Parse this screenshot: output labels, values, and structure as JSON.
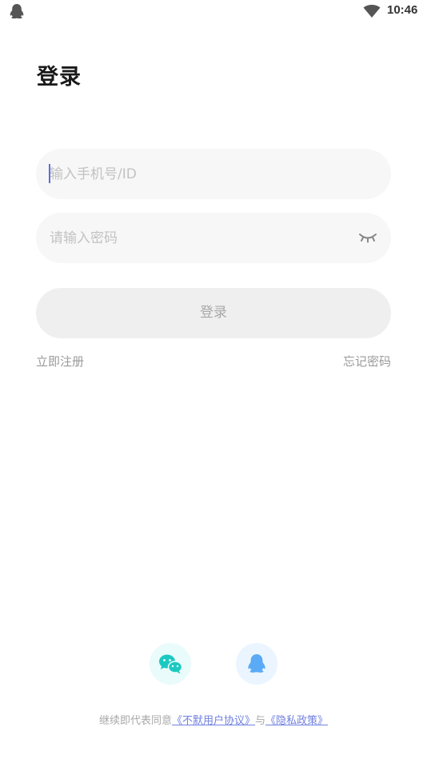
{
  "status_bar": {
    "time": "10:46",
    "left_icon": "qq-notification-icon",
    "wifi_icon": "wifi-icon"
  },
  "title": "登录",
  "phone_field": {
    "value": "",
    "placeholder": "输入手机号/ID"
  },
  "password_field": {
    "value": "",
    "placeholder": "请输入密码",
    "toggle_icon": "eye-closed-icon"
  },
  "login_button": "登录",
  "register_link": "立即注册",
  "forgot_link": "忘记密码",
  "social": [
    {
      "name": "wechat",
      "icon": "wechat-icon"
    },
    {
      "name": "qq",
      "icon": "qq-icon"
    }
  ],
  "agreement": {
    "prefix": "继续即代表同意",
    "user_agreement": "《不默用户协议》",
    "joiner": "与",
    "privacy_policy": "《隐私政策》"
  },
  "colors": {
    "accent": "#7080e0",
    "caret": "#5b6ee0",
    "wechat": "#1cc9c1",
    "qq": "#5aaaf5",
    "field_bg": "#f7f7f7",
    "button_bg": "#efefef"
  }
}
